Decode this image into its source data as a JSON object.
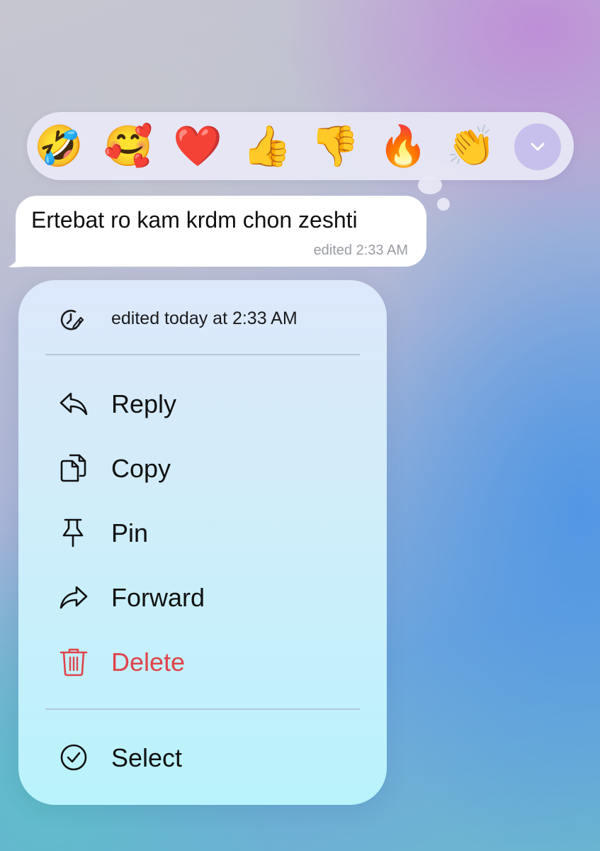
{
  "reactions": [
    {
      "emoji": "🤣",
      "name": "rolling-on-the-floor-laughing"
    },
    {
      "emoji": "🥰",
      "name": "smiling-face-with-hearts"
    },
    {
      "emoji": "❤️",
      "name": "red-heart"
    },
    {
      "emoji": "👍",
      "name": "thumbs-up"
    },
    {
      "emoji": "👎",
      "name": "thumbs-down"
    },
    {
      "emoji": "🔥",
      "name": "fire"
    },
    {
      "emoji": "👏",
      "name": "clapping-hands"
    }
  ],
  "reaction_bar": {
    "expand_icon": "chevron-down-icon"
  },
  "message": {
    "text": "Ertebat ro kam krdm chon zeshti",
    "meta": "edited 2:33 AM"
  },
  "menu": {
    "edited_info": "edited today at 2:33 AM",
    "items": [
      {
        "label": "Reply",
        "icon": "reply-icon"
      },
      {
        "label": "Copy",
        "icon": "copy-icon"
      },
      {
        "label": "Pin",
        "icon": "pin-icon"
      },
      {
        "label": "Forward",
        "icon": "forward-icon"
      },
      {
        "label": "Delete",
        "icon": "trash-icon"
      },
      {
        "label": "Select",
        "icon": "checkmark-circle-icon"
      }
    ]
  },
  "colors": {
    "danger": "#e0434b",
    "expand_button": "#c7c0ec",
    "meta_text": "#9a9ca4"
  }
}
